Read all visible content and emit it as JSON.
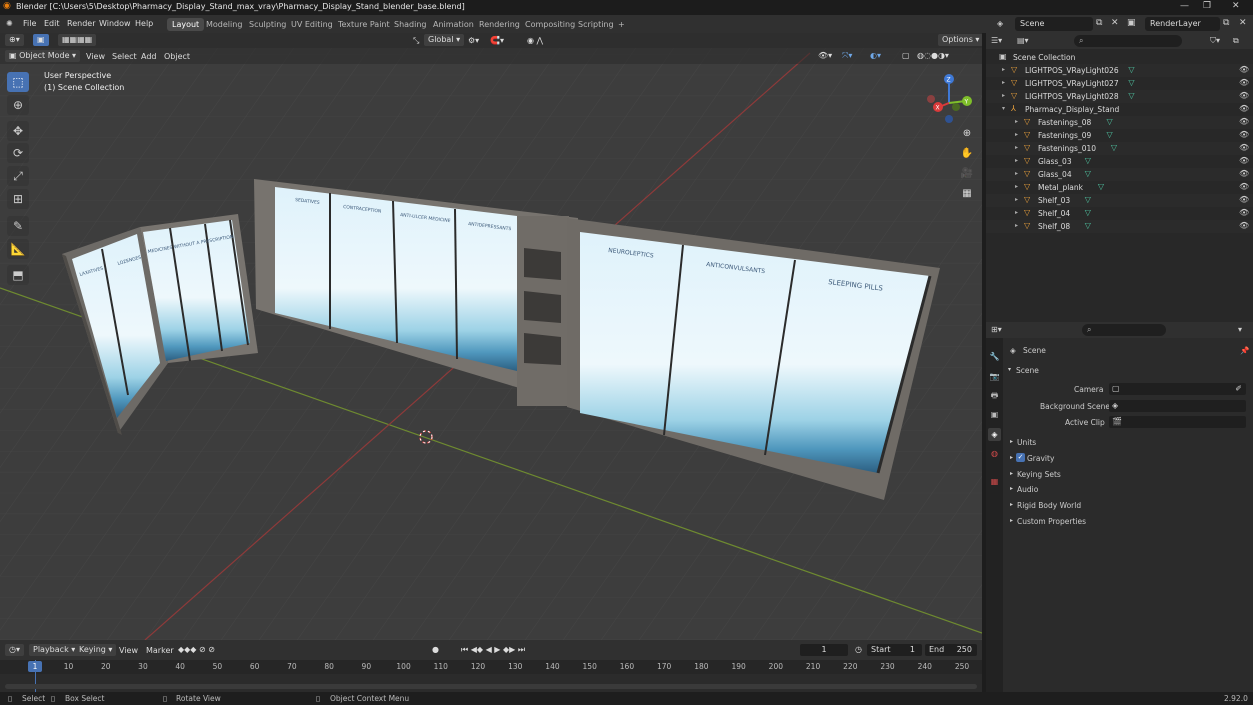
{
  "window": {
    "title": "Blender [C:\\Users\\5\\Desktop\\Pharmacy_Display_Stand_max_vray\\Pharmacy_Display_Stand_blender_base.blend]",
    "controls": [
      "—",
      "❐",
      "✕"
    ]
  },
  "menu": [
    "File",
    "Edit",
    "Render",
    "Window",
    "Help"
  ],
  "workspaces": [
    "Layout",
    "Modeling",
    "Sculpting",
    "UV Editing",
    "Texture Paint",
    "Shading",
    "Animation",
    "Rendering",
    "Compositing",
    "Scripting"
  ],
  "active_workspace": "Layout",
  "add_workspace": "+",
  "scene_field": "Scene",
  "view_layer_field": "RenderLayer",
  "viewport": {
    "orientation": "Global",
    "options_label": "Options",
    "mode": "Object Mode",
    "menus": [
      "View",
      "Select",
      "Add",
      "Object"
    ],
    "overlay_line1": "User Perspective",
    "overlay_line2": "(1) Scene Collection",
    "gizmo_axes": {
      "x": "X",
      "y": "Y",
      "z": "Z"
    },
    "panel_labels_left": [
      "LAXATIVES",
      "LOZENGES",
      "MEDICINES WITHOUT A PRESCRIPTION",
      ""
    ],
    "panel_labels_middle": [
      "SEDATIVES",
      "CONTRACEPTION",
      "ANTI-ULCER MEDICINE",
      "ANTIDEPRESSANTS"
    ],
    "panel_labels_right": [
      "NEUROLEPTICS",
      "ANTICONVULSANTS",
      "SLEEPING PILLS"
    ]
  },
  "outliner": {
    "root": "Scene Collection",
    "items": [
      {
        "name": "LIGHTPOS_VRayLight026",
        "indent": 1
      },
      {
        "name": "LIGHTPOS_VRayLight027",
        "indent": 1
      },
      {
        "name": "LIGHTPOS_VRayLight028",
        "indent": 1
      },
      {
        "name": "Pharmacy_Display_Stand",
        "indent": 1,
        "expanded": true
      },
      {
        "name": "Fastenings_08",
        "indent": 2
      },
      {
        "name": "Fastenings_09",
        "indent": 2
      },
      {
        "name": "Fastenings_010",
        "indent": 2
      },
      {
        "name": "Glass_03",
        "indent": 2
      },
      {
        "name": "Glass_04",
        "indent": 2
      },
      {
        "name": "Metal_plank",
        "indent": 2
      },
      {
        "name": "Shelf_03",
        "indent": 2
      },
      {
        "name": "Shelf_04",
        "indent": 2
      },
      {
        "name": "Shelf_08",
        "indent": 2
      }
    ]
  },
  "properties": {
    "breadcrumb": "Scene",
    "section": "Scene",
    "fields": [
      {
        "label": "Camera"
      },
      {
        "label": "Background Scene"
      },
      {
        "label": "Active Clip"
      }
    ],
    "panels": [
      "Units",
      "Gravity",
      "Keying Sets",
      "Audio",
      "Rigid Body World",
      "Custom Properties"
    ],
    "gravity_checked": true
  },
  "timeline": {
    "menus": [
      "Playback",
      "Keying",
      "View",
      "Marker"
    ],
    "current_frame": "1",
    "start_label": "Start",
    "start": "1",
    "end_label": "End",
    "end": "250",
    "ticks": [
      "1",
      "10",
      "20",
      "30",
      "40",
      "50",
      "60",
      "70",
      "80",
      "90",
      "100",
      "110",
      "120",
      "130",
      "140",
      "150",
      "160",
      "170",
      "180",
      "190",
      "200",
      "210",
      "220",
      "230",
      "240",
      "250"
    ]
  },
  "status": {
    "select": "Select",
    "box_select": "Box Select",
    "rotate": "Rotate View",
    "context": "Object Context Menu",
    "version": "2.92.0"
  }
}
